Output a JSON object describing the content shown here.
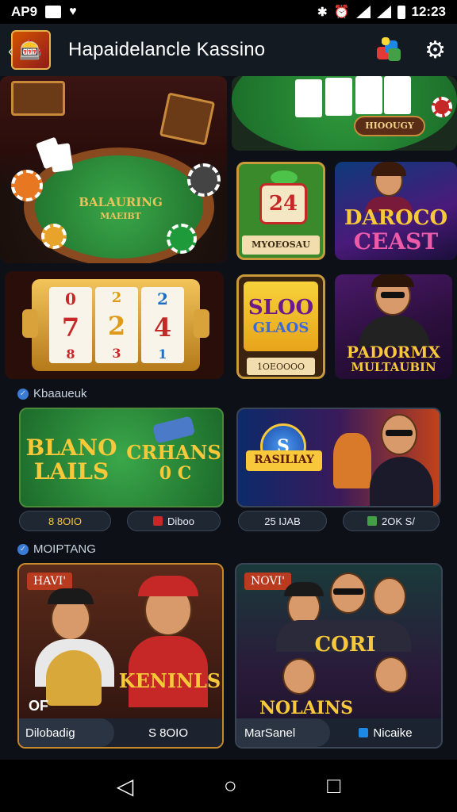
{
  "status_bar": {
    "left_text": "AP9",
    "time": "12:23"
  },
  "app_bar": {
    "title": "Hapaidelancle Kassino"
  },
  "tiles": {
    "roulette_table": {
      "label": "BALAURING",
      "sub": "MAEIBT"
    },
    "blackjack": {
      "label": "HIOOUGY"
    },
    "card24": {
      "number": "24",
      "label": "MYOEOSAU"
    },
    "daroco": {
      "line1": "DAROCO",
      "line2": "CEAST"
    },
    "slots": {
      "reel1": [
        "0",
        "7",
        "8"
      ],
      "reel2": [
        "2",
        "2",
        "3"
      ],
      "reel3": [
        "2",
        "4",
        "1"
      ]
    },
    "sloo": {
      "line1": "SLOO",
      "line2": "GLAOS",
      "button": "1OEOOOO"
    },
    "padormx": {
      "line1": "PADORMX",
      "line2": "MULTAUBIN"
    }
  },
  "section1": {
    "title": "Kbaaueuk",
    "game_a": {
      "line1": "BLANO",
      "line2": "LAILS",
      "line3": "CRHANS",
      "line4": "0 C"
    },
    "game_b": {
      "line1": "S",
      "line2": "RASILIAY"
    },
    "pills": [
      "8 8OIO",
      "Diboo",
      "25 IJAB",
      "2OK S/"
    ]
  },
  "section2": {
    "title": "MOIPTANG",
    "card_left": {
      "tag": "HAVI'",
      "title": "KENINLS",
      "badge": "OF",
      "bar_left": "Dilobadig",
      "bar_right": "S 8OIO"
    },
    "card_right": {
      "tag": "NOVI'",
      "title1": "CORI",
      "title2": "NOLAINS",
      "bar_left": "MarSanel",
      "bar_right": "Nicaike"
    }
  },
  "nav": {
    "back_icon": "triangle-back-icon",
    "home_icon": "circle-home-icon",
    "recents_icon": "square-recents-icon"
  }
}
